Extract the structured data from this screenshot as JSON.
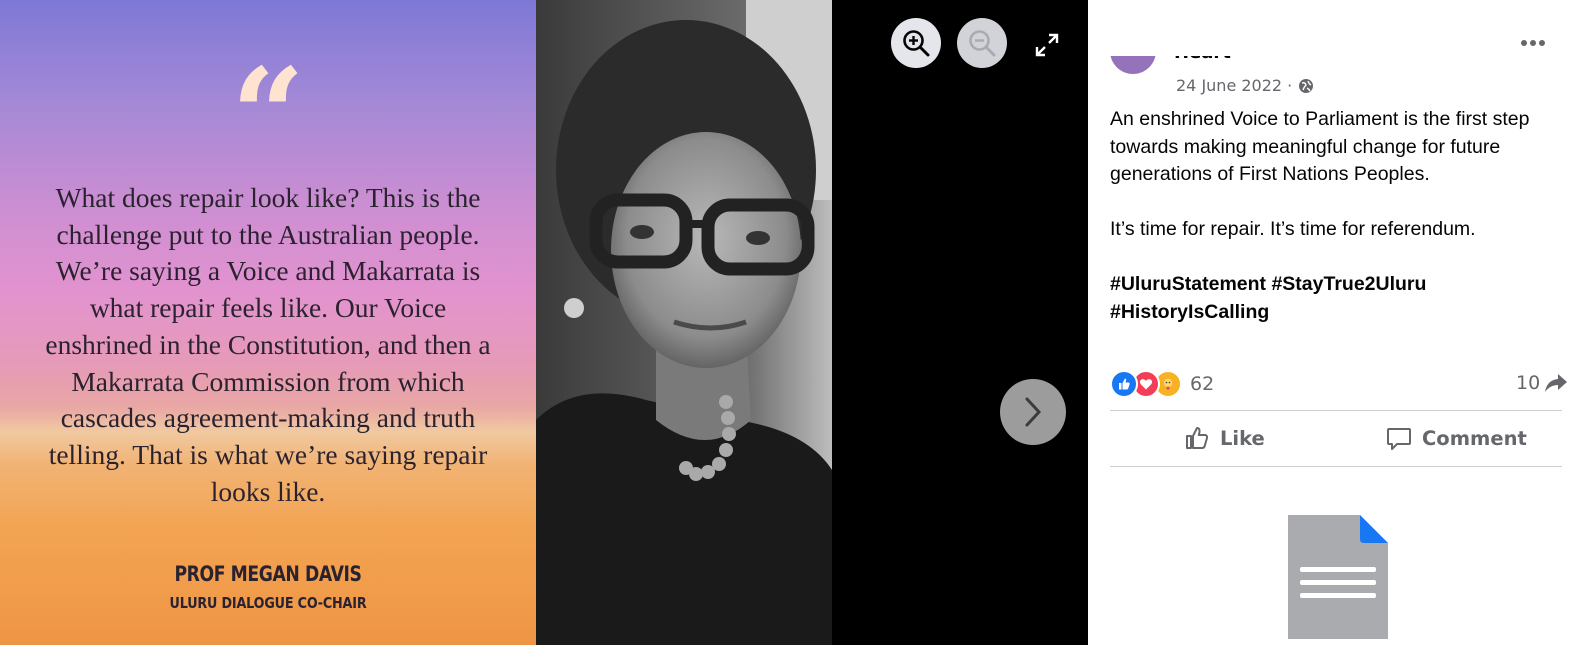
{
  "photo": {
    "quote_mark": "“",
    "quote": "What does repair look like? This is the challenge put to the Australian people. We’re saying a Voice and Makarrata is what repair feels like. Our Voice enshrined in the Constitution, and then a Makarrata Commission from which cascades agreement-making and truth telling. That is what we’re saying repair looks like.",
    "author": "PROF MEGAN DAVIS",
    "role": "ULURU DIALOGUE CO-CHAIR"
  },
  "viewer_controls": {
    "zoom_in_icon": "zoom-in-icon",
    "zoom_out_icon": "zoom-out-icon",
    "fullscreen_icon": "fullscreen-icon",
    "next_icon": "chevron-right-icon"
  },
  "post": {
    "page_name": "Heart",
    "date": "24 June 2022 ·",
    "audience_icon": "globe-icon",
    "paragraph1": "An enshrined Voice to Parliament is the first step towards making meaningful change for future generations of First Nations Peoples.",
    "paragraph2": "It’s time for repair. It’s time for referendum.",
    "hashtags": [
      "#UluruStatement",
      "#StayTrue2Uluru",
      "#HistoryIsCalling"
    ],
    "reaction_count": "62",
    "share_count": "10",
    "actions": {
      "like": "Like",
      "comment": "Comment"
    }
  },
  "colors": {
    "facebook_blue": "#1877f2",
    "love_red": "#f33e58",
    "care_yellow": "#f7b125",
    "secondary_text": "#65676b"
  }
}
